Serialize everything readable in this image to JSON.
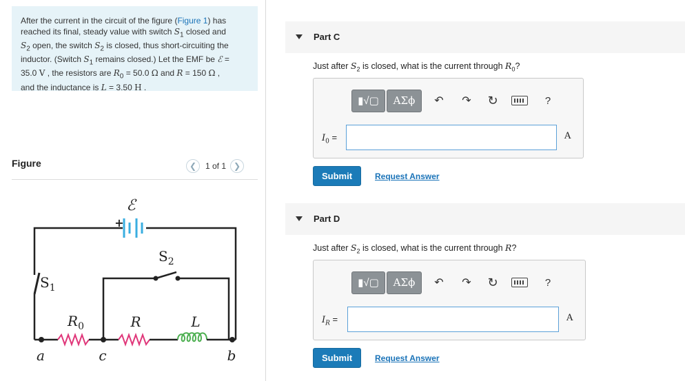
{
  "problem": {
    "line1": "After the current in the circuit of the figure (",
    "figure_link": "Figure 1",
    "line1b": ") has",
    "line2": "reached its final, steady value with switch ",
    "s1": "S",
    "s1_sub": "1",
    "line2b": " closed and",
    "s2": "S",
    "s2_sub": "2",
    "line3": " open, the switch ",
    "line3b": " is closed, thus short-circuiting the",
    "line4": "inductor. (Switch ",
    "line4b": " remains closed.) Let the EMF be ",
    "emf_symbol": "ℰ",
    "eq": " =",
    "emf_value": "35.0",
    "emf_unit": "V",
    "line5": " , the resistors are ",
    "r0": "R",
    "r0_sub": "0",
    "r0_value": " = 50.0 ",
    "ohm": "Ω",
    "and": " and ",
    "r": "R",
    "r_value": " = 150 ",
    "comma": " ,",
    "line6": "and the inductance is ",
    "l": "L",
    "l_value": " = 3.50 ",
    "l_unit": "H",
    "period": " ."
  },
  "figure": {
    "title": "Figure",
    "pager_text": "1 of 1",
    "prev_icon": "chevron-left-icon",
    "next_icon": "chevron-right-icon",
    "labels": {
      "emf": "ℰ",
      "plus": "+",
      "s2": "S",
      "s2_sub": "2",
      "s1": "S",
      "s1_sub": "1",
      "r0": "R",
      "r0_sub": "0",
      "r": "R",
      "l": "L",
      "a": "a",
      "c": "c",
      "b": "b"
    },
    "colors": {
      "wire": "#222222",
      "battery": "#3aaee0",
      "resistor": "#e0377a",
      "inductor": "#4caf50"
    }
  },
  "partC": {
    "title": "Part C",
    "question_pre": "Just after ",
    "question_sym": "S",
    "question_sym_sub": "2",
    "question_mid": " is closed, what is the current through ",
    "question_target": "R",
    "question_target_sub": "0",
    "question_end": "?",
    "var_symbol": "I",
    "var_sub": "0",
    "var_eq": " =",
    "input_value": "",
    "unit": "A",
    "submit": "Submit",
    "request": "Request Answer"
  },
  "partD": {
    "title": "Part D",
    "question_pre": "Just after ",
    "question_sym": "S",
    "question_sym_sub": "2",
    "question_mid": " is closed, what is the current through ",
    "question_target": "R",
    "question_end": "?",
    "var_symbol": "I",
    "var_sub": "R",
    "var_eq": " =",
    "input_value": "",
    "unit": "A",
    "submit": "Submit",
    "request": "Request Answer"
  },
  "toolbar": {
    "frac_label": "▮√▢",
    "greek_label": "ΑΣϕ",
    "undo": "↶",
    "redo": "↷",
    "reset": "↻",
    "help": "?"
  },
  "colors": {
    "accent": "#1b7bb8",
    "link": "#1a73b8",
    "problem_bg": "#e6f3f8"
  }
}
